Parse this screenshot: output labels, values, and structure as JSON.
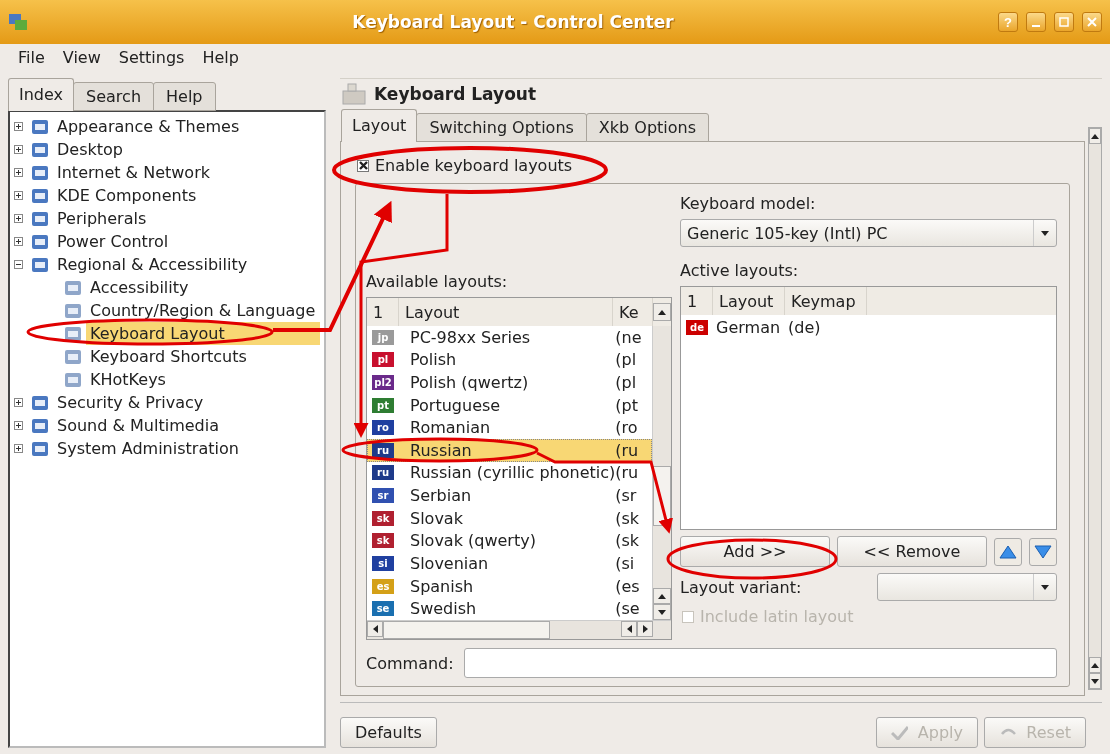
{
  "window": {
    "title": "Keyboard Layout - Control Center",
    "help_button": "?"
  },
  "menu": [
    "File",
    "View",
    "Settings",
    "Help"
  ],
  "sidebar": {
    "tabs": [
      {
        "label": "Index",
        "selected": true
      },
      {
        "label": "Search",
        "selected": false
      },
      {
        "label": "Help",
        "selected": false
      }
    ],
    "tree": [
      {
        "label": "Appearance & Themes",
        "expanded": false,
        "selected": false
      },
      {
        "label": "Desktop",
        "expanded": false,
        "selected": false
      },
      {
        "label": "Internet & Network",
        "expanded": false,
        "selected": false
      },
      {
        "label": "KDE Components",
        "expanded": false,
        "selected": false
      },
      {
        "label": "Peripherals",
        "expanded": false,
        "selected": false
      },
      {
        "label": "Power Control",
        "expanded": false,
        "selected": false
      },
      {
        "label": "Regional & Accessibility",
        "expanded": true,
        "selected": false,
        "children": [
          {
            "label": "Accessibility",
            "selected": false
          },
          {
            "label": "Country/Region & Language",
            "selected": false
          },
          {
            "label": "Keyboard Layout",
            "selected": true
          },
          {
            "label": "Keyboard Shortcuts",
            "selected": false
          },
          {
            "label": "KHotKeys",
            "selected": false
          }
        ]
      },
      {
        "label": "Security & Privacy",
        "expanded": false,
        "selected": false
      },
      {
        "label": "Sound & Multimedia",
        "expanded": false,
        "selected": false
      },
      {
        "label": "System Administration",
        "expanded": false,
        "selected": false
      }
    ]
  },
  "module": {
    "title": "Keyboard Layout",
    "tabs": [
      {
        "label": "Layout",
        "selected": true
      },
      {
        "label": "Switching Options",
        "selected": false
      },
      {
        "label": "Xkb Options",
        "selected": false
      }
    ],
    "enable_checkbox": {
      "label": "Enable keyboard layouts",
      "checked": true
    },
    "available": {
      "label": "Available layouts:",
      "columns": [
        "1",
        "Layout",
        "Ke"
      ],
      "rows": [
        {
          "flag": "jp",
          "layout": "PC-98xx Series",
          "keymap": "(ne",
          "selected": false,
          "color": "#9a9a9a"
        },
        {
          "flag": "pl",
          "layout": "Polish",
          "keymap": "(pl",
          "selected": false,
          "color": "#c8102e"
        },
        {
          "flag": "pl2",
          "layout": "Polish (qwertz)",
          "keymap": "(pl",
          "selected": false,
          "color": "#6a2a8a"
        },
        {
          "flag": "pt",
          "layout": "Portuguese",
          "keymap": "(pt",
          "selected": false,
          "color": "#2e7d32"
        },
        {
          "flag": "ro",
          "layout": "Romanian",
          "keymap": "(ro",
          "selected": false,
          "color": "#1f3fa0"
        },
        {
          "flag": "ru",
          "layout": "Russian",
          "keymap": "(ru",
          "selected": true,
          "color": "#1e3a8a"
        },
        {
          "flag": "ru",
          "layout": "Russian (cyrillic phonetic)",
          "keymap": "(ru",
          "selected": false,
          "color": "#1e3a8a"
        },
        {
          "flag": "sr",
          "layout": "Serbian",
          "keymap": "(sr",
          "selected": false,
          "color": "#3050b0"
        },
        {
          "flag": "sk",
          "layout": "Slovak",
          "keymap": "(sk",
          "selected": false,
          "color": "#b02030"
        },
        {
          "flag": "sk",
          "layout": "Slovak (qwerty)",
          "keymap": "(sk",
          "selected": false,
          "color": "#b02030"
        },
        {
          "flag": "si",
          "layout": "Slovenian",
          "keymap": "(si",
          "selected": false,
          "color": "#2040a0"
        },
        {
          "flag": "es",
          "layout": "Spanish",
          "keymap": "(es",
          "selected": false,
          "color": "#d4a017"
        },
        {
          "flag": "se",
          "layout": "Swedish",
          "keymap": "(se",
          "selected": false,
          "color": "#1a6fb0"
        }
      ]
    },
    "keyboard_model": {
      "label": "Keyboard model:",
      "value": "Generic 105-key (Intl) PC"
    },
    "active": {
      "label": "Active layouts:",
      "columns": [
        "1",
        "Layout",
        "Keymap"
      ],
      "rows": [
        {
          "flag": "de",
          "layout": "German",
          "keymap": "(de)",
          "color": "#cc0000"
        }
      ]
    },
    "add_button": "Add >>",
    "remove_button": "<< Remove",
    "layout_variant": {
      "label": "Layout variant:"
    },
    "include_latin": {
      "label": "Include latin layout",
      "checked": false,
      "disabled": true
    },
    "command": {
      "label": "Command:"
    }
  },
  "footer": {
    "defaults": "Defaults",
    "apply": {
      "label": "Apply",
      "disabled": true
    },
    "reset": {
      "label": "Reset",
      "disabled": true
    }
  }
}
